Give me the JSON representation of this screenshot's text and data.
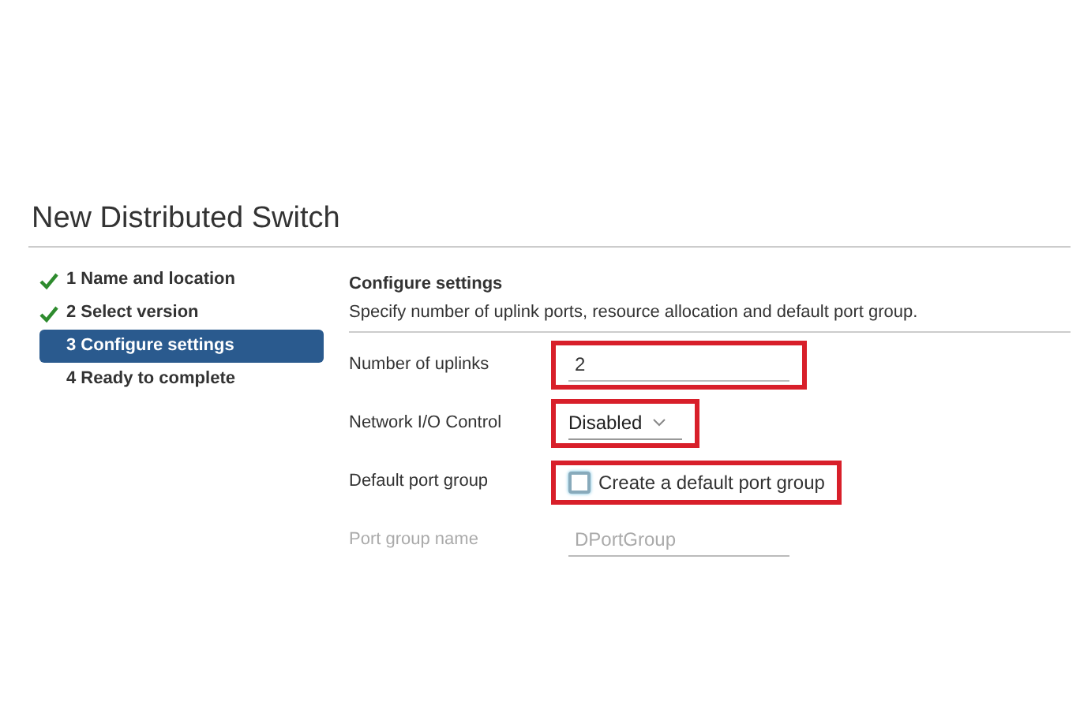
{
  "window": {
    "title": "New Distributed Switch"
  },
  "steps": [
    {
      "label": "1 Name and location",
      "done": true,
      "selected": false
    },
    {
      "label": "2 Select version",
      "done": true,
      "selected": false
    },
    {
      "label": "3 Configure settings",
      "done": false,
      "selected": true
    },
    {
      "label": "4 Ready to complete",
      "done": false,
      "selected": false
    }
  ],
  "section": {
    "title": "Configure settings",
    "description": "Specify number of uplink ports, resource allocation and default port group."
  },
  "fields": [
    {
      "kind": "text",
      "label": "Number of uplinks",
      "value": "2",
      "disabled": false,
      "highlighted": true
    },
    {
      "kind": "select",
      "label": "Network I/O Control",
      "value": "Disabled",
      "disabled": false,
      "highlighted": true
    },
    {
      "kind": "checkbox",
      "label": "Default port group",
      "text": "Create a default port group",
      "checked": false,
      "disabled": false,
      "highlighted": true
    },
    {
      "kind": "text",
      "label": "Port group name",
      "value": "DPortGroup",
      "disabled": true
    }
  ]
}
